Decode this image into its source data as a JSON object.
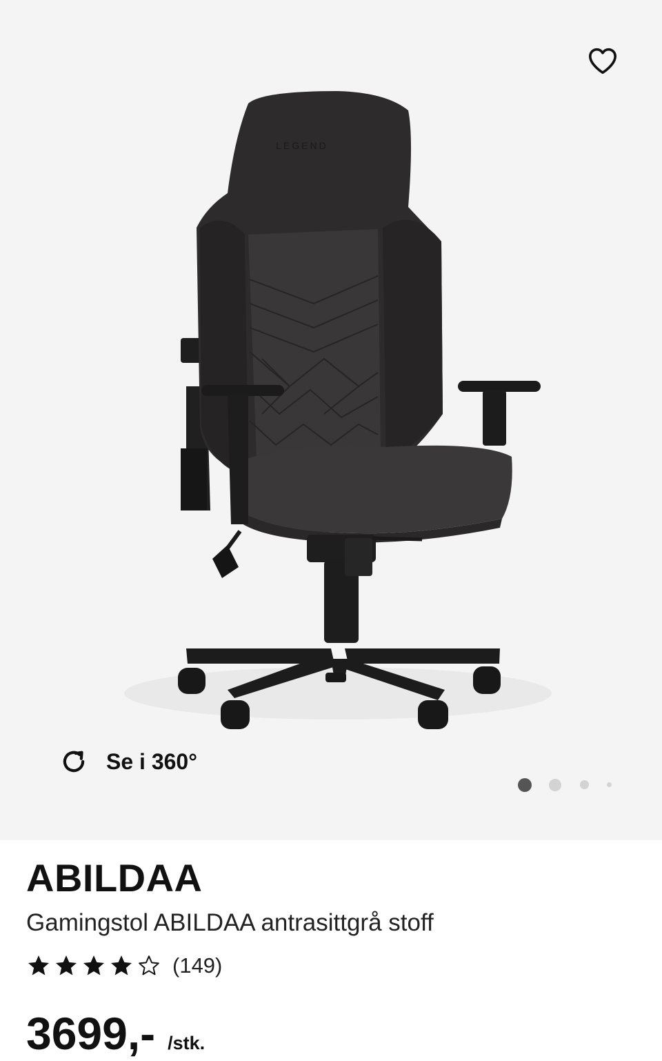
{
  "gallery": {
    "logo_text": "LEGEND",
    "favorite_icon": "heart-outline-icon",
    "view360": {
      "icon": "rotate-icon",
      "label": "Se i 360°"
    },
    "pagination": {
      "total": 4,
      "active_index": 0
    }
  },
  "product": {
    "brand": "ABILDAA",
    "subtitle": "Gamingstol ABILDAA antrasittgrå stoff",
    "rating": {
      "stars_filled": 4,
      "stars_total": 5,
      "review_count": "(149)"
    },
    "price": "3699,-",
    "unit": "/stk."
  },
  "colors": {
    "background": "#f4f4f4",
    "text": "#111111",
    "chair_fabric": "#3a3738",
    "chair_frame": "#1b1b1b"
  }
}
